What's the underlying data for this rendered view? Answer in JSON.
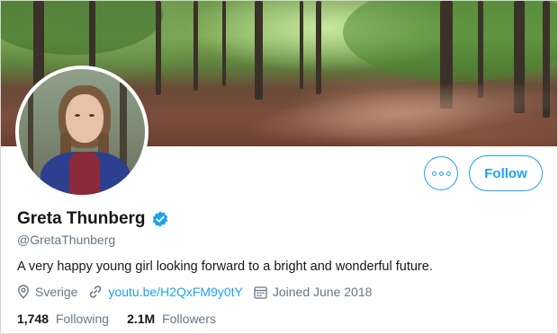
{
  "profile": {
    "name": "Greta Thunberg",
    "handle": "@GretaThunberg",
    "bio": "A very happy young girl looking forward to a bright and wonderful future.",
    "location": "Sverige",
    "website": "youtu.be/H2QxFM9y0tY",
    "joined": "Joined June 2018",
    "verified": true
  },
  "actions": {
    "follow_label": "Follow"
  },
  "stats": {
    "following_count": "1,748",
    "following_label": "Following",
    "followers_count": "2.1M",
    "followers_label": "Followers"
  },
  "icons": {
    "verified": "verified-badge-icon",
    "more": "more-options-icon",
    "location": "location-pin-icon",
    "link": "link-icon",
    "calendar": "calendar-icon"
  },
  "colors": {
    "accent": "#1da1f2",
    "text_primary": "#14171a",
    "text_secondary": "#657786"
  }
}
